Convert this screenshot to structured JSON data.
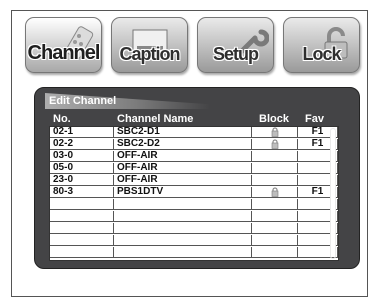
{
  "tabs": [
    {
      "label": "Channel",
      "icon": "remote-icon",
      "active": true
    },
    {
      "label": "Caption",
      "icon": "caption-screen-icon",
      "active": false
    },
    {
      "label": "Setup",
      "icon": "wrench-icon",
      "active": false
    },
    {
      "label": "Lock",
      "icon": "padlock-icon",
      "active": false
    }
  ],
  "panel": {
    "title": "Edit Channel",
    "headers": {
      "no": "No.",
      "name": "Channel Name",
      "block": "Block",
      "fav": "Fav"
    },
    "rows": [
      {
        "no": "02-1",
        "name": "SBC2-D1",
        "blocked": true,
        "fav": "F1"
      },
      {
        "no": "02-2",
        "name": "SBC2-D2",
        "blocked": true,
        "fav": "F1"
      },
      {
        "no": "03-0",
        "name": "OFF-AIR",
        "blocked": false,
        "fav": ""
      },
      {
        "no": "05-0",
        "name": "OFF-AIR",
        "blocked": false,
        "fav": ""
      },
      {
        "no": "23-0",
        "name": "OFF-AIR",
        "blocked": false,
        "fav": ""
      },
      {
        "no": "80-3",
        "name": "PBS1DTV",
        "blocked": true,
        "fav": "F1"
      },
      {
        "no": "",
        "name": "",
        "blocked": false,
        "fav": ""
      },
      {
        "no": "",
        "name": "",
        "blocked": false,
        "fav": ""
      },
      {
        "no": "",
        "name": "",
        "blocked": false,
        "fav": ""
      },
      {
        "no": "",
        "name": "",
        "blocked": false,
        "fav": ""
      },
      {
        "no": "",
        "name": "",
        "blocked": false,
        "fav": ""
      }
    ]
  },
  "colors": {
    "panel": "#444446",
    "tab_gradient_top": "#eaeaea",
    "tab_gradient_bottom": "#9a9a9a"
  }
}
